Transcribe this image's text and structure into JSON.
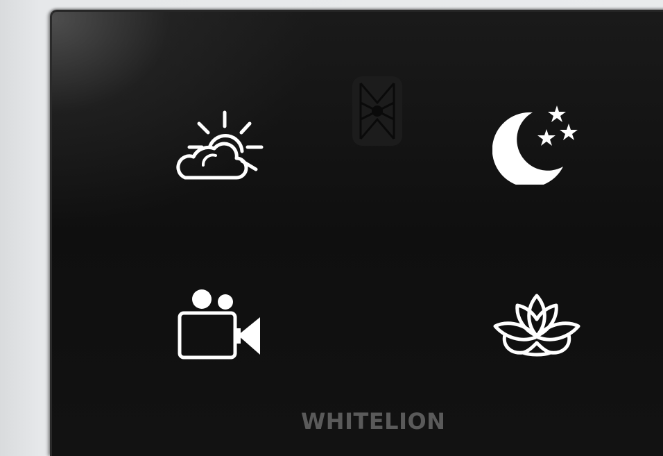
{
  "panel": {
    "brand_label": "WHITELION",
    "buttons": [
      {
        "icon": "sun-cloud-icon",
        "scene": "day"
      },
      {
        "icon": "moon-stars-icon",
        "scene": "night"
      },
      {
        "icon": "video-camera-icon",
        "scene": "movie"
      },
      {
        "icon": "lotus-icon",
        "scene": "relax"
      }
    ],
    "sensor_icon": "proximity-sensor-icon",
    "colors": {
      "panel": "#121212",
      "icon": "#ffffff",
      "brand": "#5a5a5a",
      "wall": "#e6e8ea"
    }
  }
}
